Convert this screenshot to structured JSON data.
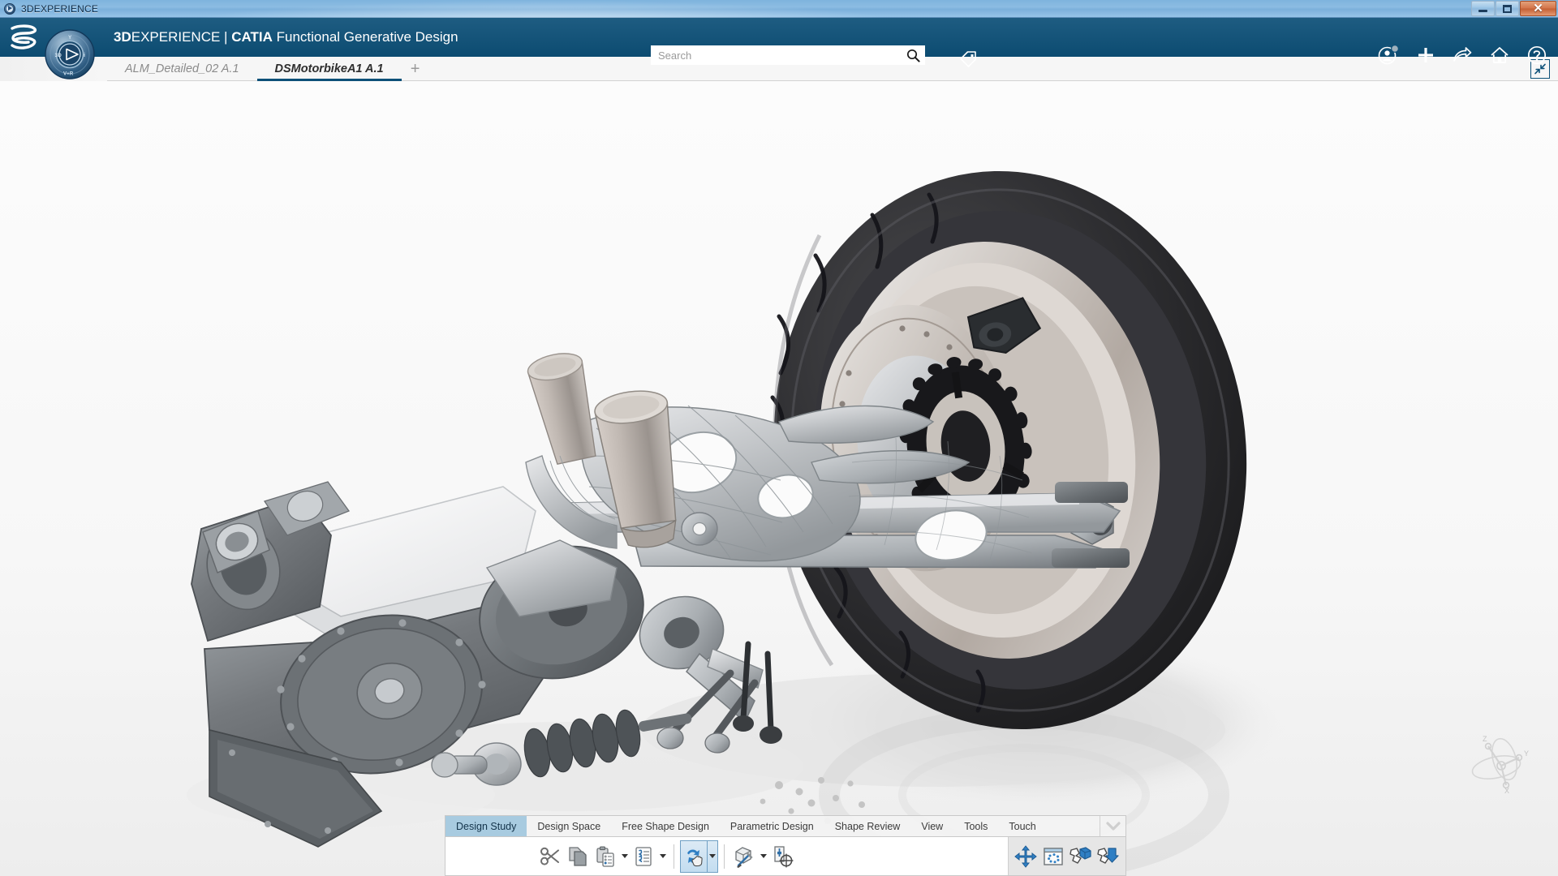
{
  "window": {
    "title": "3DEXPERIENCE",
    "app_icon": "compass-icon",
    "controls": {
      "minimize": "minimize-icon",
      "maximize": "maximize-icon",
      "close": "close-icon"
    }
  },
  "header": {
    "brand_bold": "3D",
    "brand_regular": "EXPERIENCE",
    "brand_separator": " | ",
    "brand_product": "CATIA",
    "brand_app": " Functional Generative Design",
    "logo": "3ds-logo",
    "compass": {
      "name": "3dexperience-compass",
      "label_left": "3D",
      "label_right": "i",
      "label_top": "Y",
      "label_bottom": "V+R"
    },
    "icons": {
      "user": "user-profile-icon",
      "add": "plus-icon",
      "share": "share-arrow-icon",
      "home": "home-icon",
      "help": "help-question-icon",
      "tag": "tag-icon"
    }
  },
  "search": {
    "placeholder": "Search",
    "value": "",
    "icon": "search-magnifier-icon"
  },
  "tabs": {
    "items": [
      {
        "label": "ALM_Detailed_02 A.1",
        "active": false
      },
      {
        "label": "DSMotorbikeA1 A.1",
        "active": true
      }
    ],
    "add_label": "+",
    "collapse_icon": "collapse-diagonal-icon"
  },
  "viewport": {
    "model_name": "DSMotorbikeA1",
    "axis_triad": {
      "x": "X",
      "y": "Y",
      "z": "Z"
    },
    "colors": {
      "background_top": "#fbfbfb",
      "background_bottom": "#efefef",
      "tire_dark": "#2b2b2d",
      "metal_light": "#cfd2d4",
      "metal_mid": "#9aa0a4",
      "metal_dark": "#6b7074",
      "shadow": "#d9d9d9",
      "accent_blue": "#0d5078"
    }
  },
  "action_bar": {
    "tabs": [
      {
        "label": "Design Study",
        "active": true
      },
      {
        "label": "Design Space",
        "active": false
      },
      {
        "label": "Free Shape Design",
        "active": false
      },
      {
        "label": "Parametric Design",
        "active": false
      },
      {
        "label": "Shape Review",
        "active": false
      },
      {
        "label": "View",
        "active": false
      },
      {
        "label": "Tools",
        "active": false
      },
      {
        "label": "Touch",
        "active": false
      }
    ],
    "chevron_icon": "chevron-down-icon",
    "commands": [
      {
        "name": "cut-button",
        "icon": "scissors-icon",
        "caret": false,
        "selected": false
      },
      {
        "name": "copy-button",
        "icon": "copy-pages-icon",
        "caret": false,
        "selected": false
      },
      {
        "name": "paste-button",
        "icon": "clipboard-paste-icon",
        "caret": true,
        "selected": false
      },
      {
        "name": "paste-special-button",
        "icon": "clipboard-list-icon",
        "caret": true,
        "selected": false
      },
      {
        "name": "update-button",
        "icon": "update-refresh-icon",
        "caret": true,
        "selected": true
      },
      {
        "name": "design-tools-button",
        "icon": "box-tools-icon",
        "caret": true,
        "selected": false
      },
      {
        "name": "measure-button",
        "icon": "measure-target-icon",
        "caret": false,
        "selected": false
      }
    ],
    "commands_right": [
      {
        "name": "compass-move-button",
        "icon": "four-way-arrows-icon"
      },
      {
        "name": "selection-window-button",
        "icon": "dotted-frame-icon"
      },
      {
        "name": "explode-cube-button",
        "icon": "explode-cube-icon"
      },
      {
        "name": "explode-shape-button",
        "icon": "explode-shape-icon"
      }
    ]
  }
}
